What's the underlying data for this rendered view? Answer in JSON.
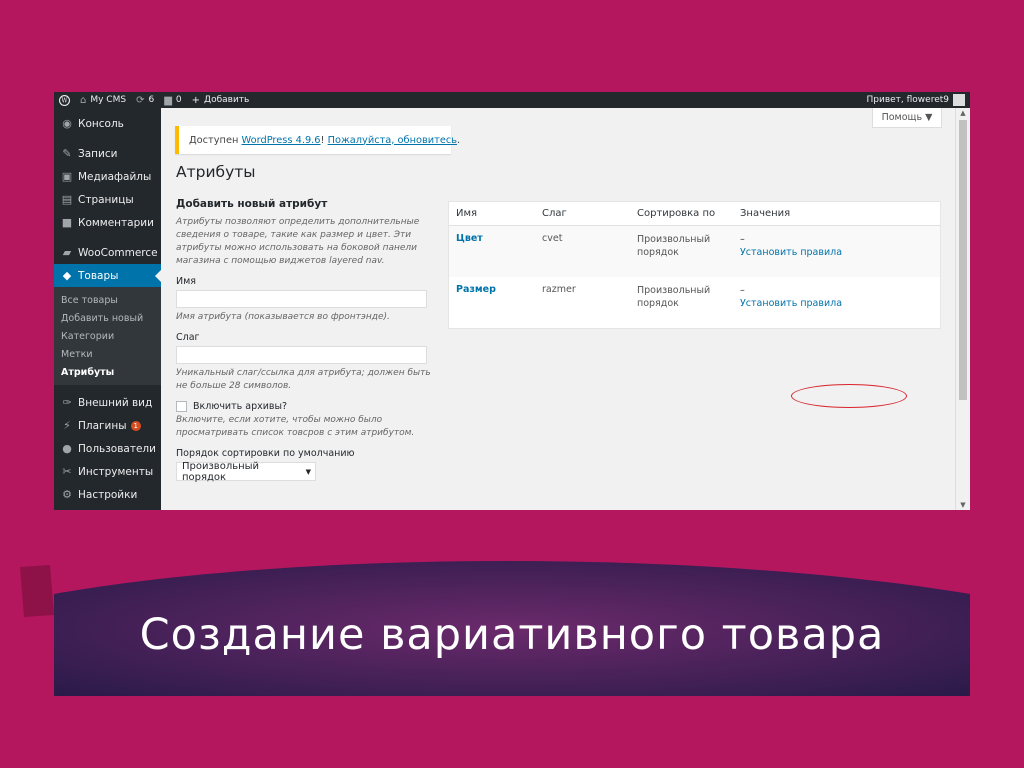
{
  "adminbar": {
    "site_name": "My CMS",
    "updates_count": "6",
    "comments_count": "0",
    "add_label": "Добавить",
    "greeting": "Привет, floweret9"
  },
  "sidebar": {
    "items": [
      {
        "label": "Консоль",
        "icon": "dashboard-icon"
      },
      {
        "label": "Записи",
        "icon": "pin-icon"
      },
      {
        "label": "Медиафайлы",
        "icon": "media-icon"
      },
      {
        "label": "Страницы",
        "icon": "pages-icon"
      },
      {
        "label": "Комментарии",
        "icon": "comments-icon"
      },
      {
        "label": "WooCommerce",
        "icon": "woocommerce-icon"
      },
      {
        "label": "Товары",
        "icon": "products-icon"
      },
      {
        "label": "Внешний вид",
        "icon": "appearance-icon"
      },
      {
        "label": "Плагины",
        "icon": "plugins-icon",
        "badge": "1"
      },
      {
        "label": "Пользователи",
        "icon": "users-icon"
      },
      {
        "label": "Инструменты",
        "icon": "tools-icon"
      },
      {
        "label": "Настройки",
        "icon": "settings-icon"
      }
    ],
    "submenu": [
      "Все товары",
      "Добавить новый",
      "Категории",
      "Метки",
      "Атрибуты"
    ]
  },
  "screen_options": "Помощь ▼",
  "notice": {
    "prefix": "Доступен ",
    "link1": "WordPress 4.9.6",
    "middle": "! ",
    "link2": "Пожалуйста, обновитесь",
    "suffix": "."
  },
  "page_title": "Атрибуты",
  "form": {
    "heading": "Добавить новый атрибут",
    "intro": "Атрибуты позволяют определить дополнительные сведения о товаре, такие как размер и цвет. Эти атрибуты можно использовать на боковой панели магазина с помощью виджетов layered nav.",
    "name_label": "Имя",
    "name_help": "Имя атрибута (показывается во фронтэнде).",
    "slug_label": "Слаг",
    "slug_help": "Уникальный слаг/ссылка для атрибута; должен быть не больше 28 символов.",
    "archives_label": "Включить архивы?",
    "archives_help": "Включите, если хотите, чтобы можно было просматривать список товсров с этим атрибутом.",
    "sort_label": "Порядок сортировки по умолчанию",
    "sort_value": "Произвольный порядок"
  },
  "table": {
    "headers": [
      "Имя",
      "Слаг",
      "Сортировка по",
      "Значения"
    ],
    "rows": [
      {
        "name": "Цвет",
        "slug": "cvet",
        "sort": "Произвольный порядок",
        "dash": "–",
        "action": "Установить правила"
      },
      {
        "name": "Размер",
        "slug": "razmer",
        "sort": "Произвольный порядок",
        "dash": "–",
        "action": "Установить правила"
      }
    ]
  },
  "slide_title": "Создание вариативного товара",
  "colors": {
    "background": "#b5175f",
    "banner": "#2d1a4f",
    "admin_dark": "#23282d",
    "accent": "#0073aa",
    "highlight_circle": "#d9232d"
  }
}
